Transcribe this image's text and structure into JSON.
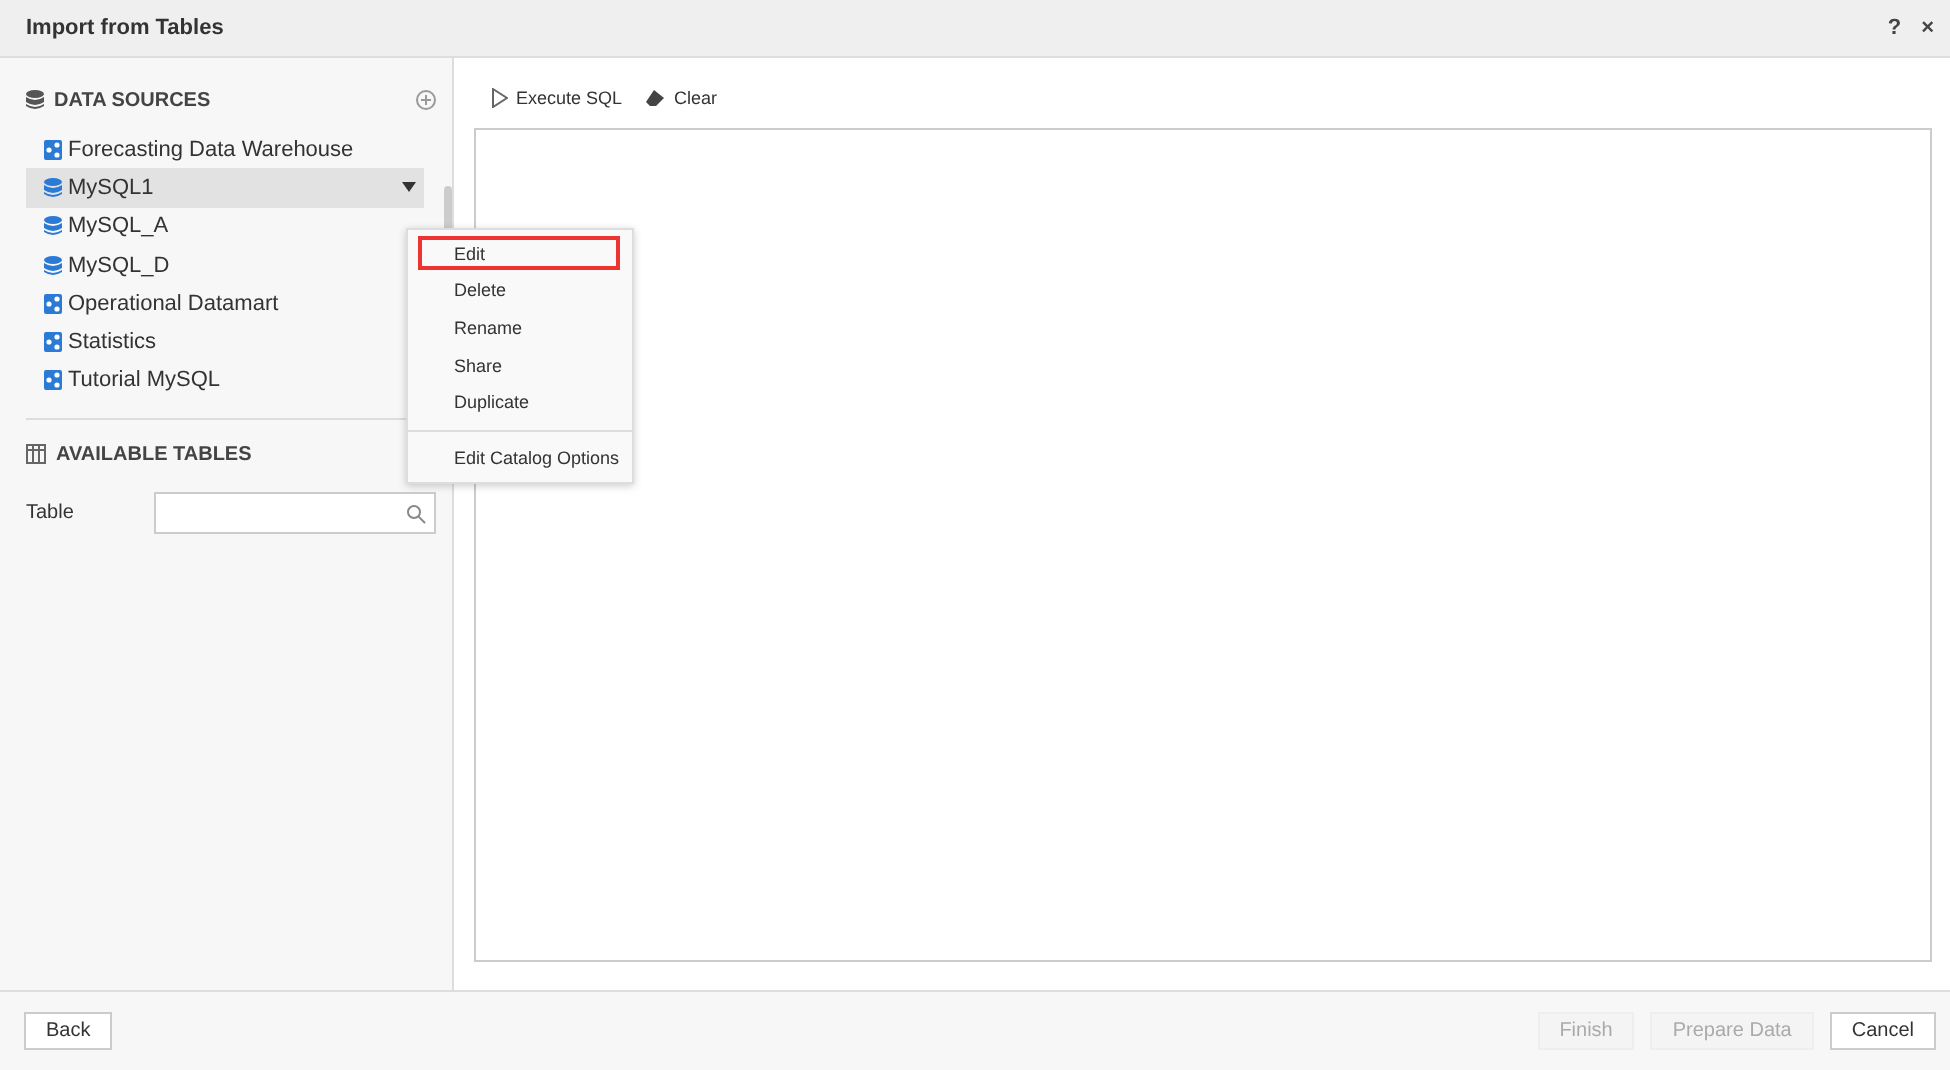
{
  "window": {
    "title": "Import from Tables",
    "help": "?",
    "close": "×"
  },
  "data_sources": {
    "heading": "DATA SOURCES",
    "items": [
      {
        "label": "Forecasting Data Warehouse",
        "kind": "cube",
        "selected": false
      },
      {
        "label": "MySQL1",
        "kind": "mysql",
        "selected": true
      },
      {
        "label": "MySQL_A",
        "kind": "mysql",
        "selected": false
      },
      {
        "label": "MySQL_D",
        "kind": "mysql",
        "selected": false
      },
      {
        "label": "Operational Datamart",
        "kind": "cube",
        "selected": false
      },
      {
        "label": "Statistics",
        "kind": "cube",
        "selected": false
      },
      {
        "label": "Tutorial MySQL",
        "kind": "cube",
        "selected": false
      }
    ]
  },
  "context_menu": {
    "groups": [
      [
        {
          "label": "Edit",
          "highlighted": true
        },
        {
          "label": "Delete",
          "highlighted": false
        },
        {
          "label": "Rename",
          "highlighted": false
        },
        {
          "label": "Share",
          "highlighted": false
        },
        {
          "label": "Duplicate",
          "highlighted": false
        }
      ],
      [
        {
          "label": "Edit Catalog Options",
          "highlighted": false
        }
      ]
    ]
  },
  "available_tables": {
    "heading": "AVAILABLE TABLES",
    "field_label": "Table"
  },
  "toolbar": {
    "execute": "Execute SQL",
    "clear": "Clear"
  },
  "footer": {
    "back": "Back",
    "buttons": [
      {
        "label": "Finish",
        "disabled": true
      },
      {
        "label": "Prepare Data",
        "disabled": true
      },
      {
        "label": "Cancel",
        "disabled": false
      }
    ]
  }
}
